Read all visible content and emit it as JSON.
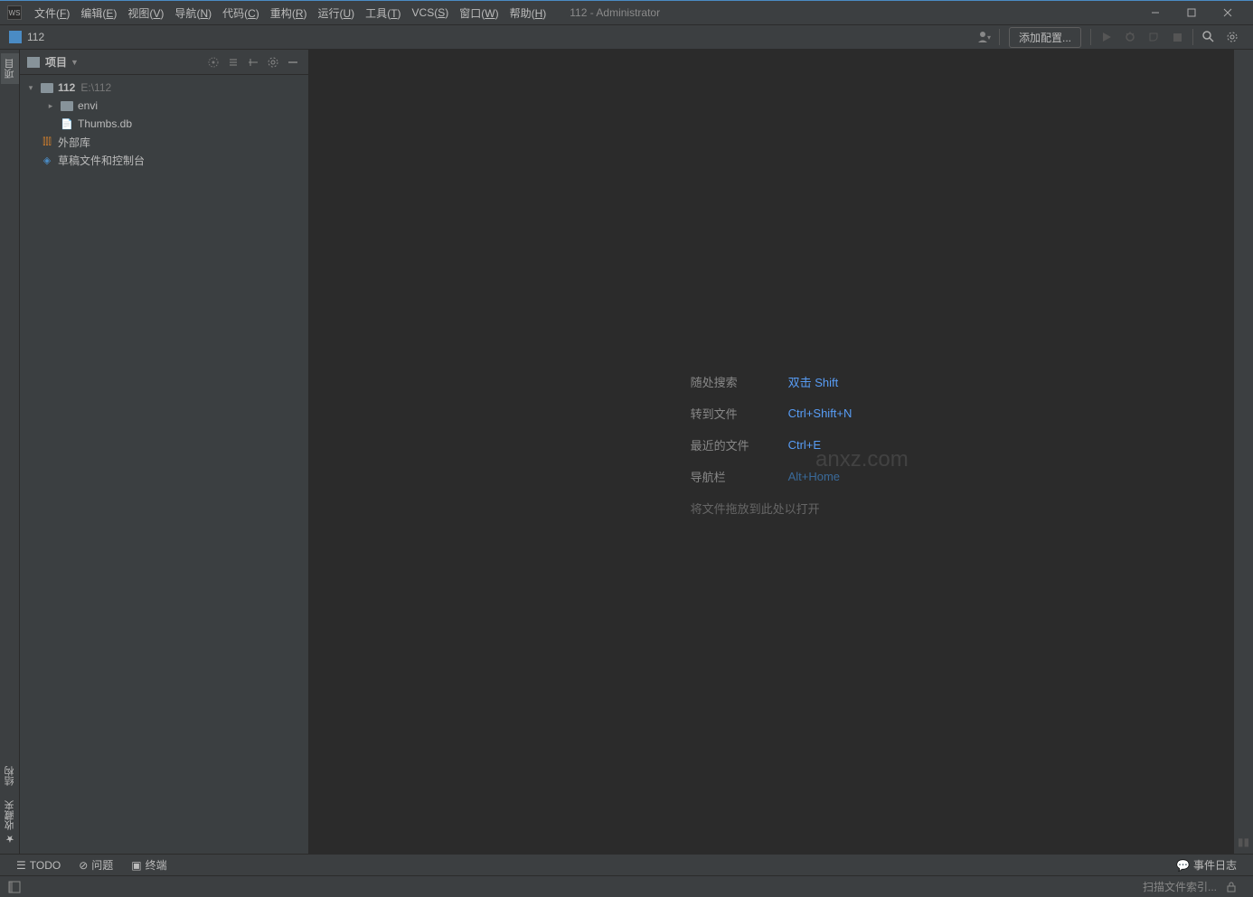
{
  "menubar": {
    "items": [
      {
        "label": "文件",
        "mn": "F"
      },
      {
        "label": "编辑",
        "mn": "E"
      },
      {
        "label": "视图",
        "mn": "V"
      },
      {
        "label": "导航",
        "mn": "N"
      },
      {
        "label": "代码",
        "mn": "C"
      },
      {
        "label": "重构",
        "mn": "R"
      },
      {
        "label": "运行",
        "mn": "U"
      },
      {
        "label": "工具",
        "mn": "T"
      },
      {
        "label": "VCS",
        "mn": "S"
      },
      {
        "label": "窗口",
        "mn": "W"
      },
      {
        "label": "帮助",
        "mn": "H"
      }
    ],
    "title": "112 - Administrator"
  },
  "toolbar": {
    "project_name": "112",
    "add_config": "添加配置..."
  },
  "sidebar": {
    "title": "项目",
    "tree": {
      "root": {
        "name": "112",
        "path": "E:\\112"
      },
      "envi": "envi",
      "thumbs": "Thumbs.db",
      "external": "外部库",
      "scratches": "草稿文件和控制台"
    }
  },
  "left_tabs": {
    "project": "项目",
    "structure": "结构",
    "favorites": "收藏夹"
  },
  "editor_hints": {
    "search_everywhere": {
      "label": "随处搜索",
      "shortcut": "双击 Shift"
    },
    "go_to_file": {
      "label": "转到文件",
      "shortcut": "Ctrl+Shift+N"
    },
    "recent_files": {
      "label": "最近的文件",
      "shortcut": "Ctrl+E"
    },
    "navbar": {
      "label": "导航栏",
      "shortcut": "Alt+Home"
    },
    "drop_files": {
      "label": "将文件拖放到此处以打开"
    }
  },
  "bottom_tabs": {
    "todo": "TODO",
    "problems": "问题",
    "terminal": "终端",
    "event_log": "事件日志"
  },
  "statusbar": {
    "indexing": "扫描文件索引..."
  },
  "watermark": "anxz.com"
}
